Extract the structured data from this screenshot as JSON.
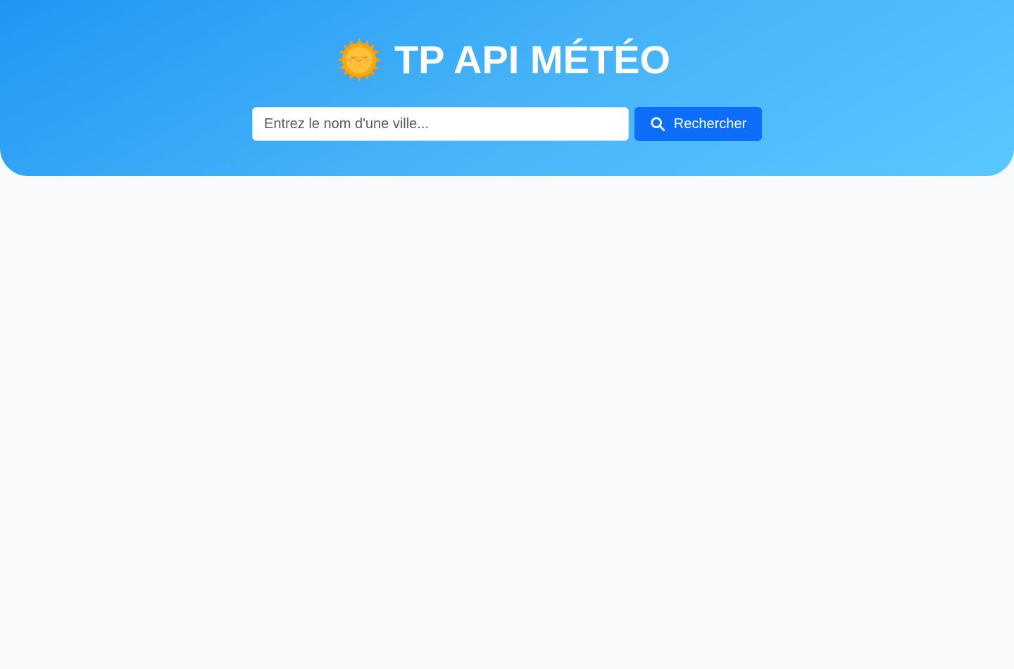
{
  "header": {
    "title": "TP API MÉTÉO",
    "logo_icon": "sun-face-icon",
    "gradient_start": "#2196f3",
    "gradient_end": "#59c8ff"
  },
  "search": {
    "placeholder": "Entrez le nom d'une ville...",
    "value": "",
    "button_label": "Rechercher",
    "button_icon": "search-icon",
    "button_color": "#0d6efd"
  },
  "page": {
    "background": "#f7f9fb"
  }
}
